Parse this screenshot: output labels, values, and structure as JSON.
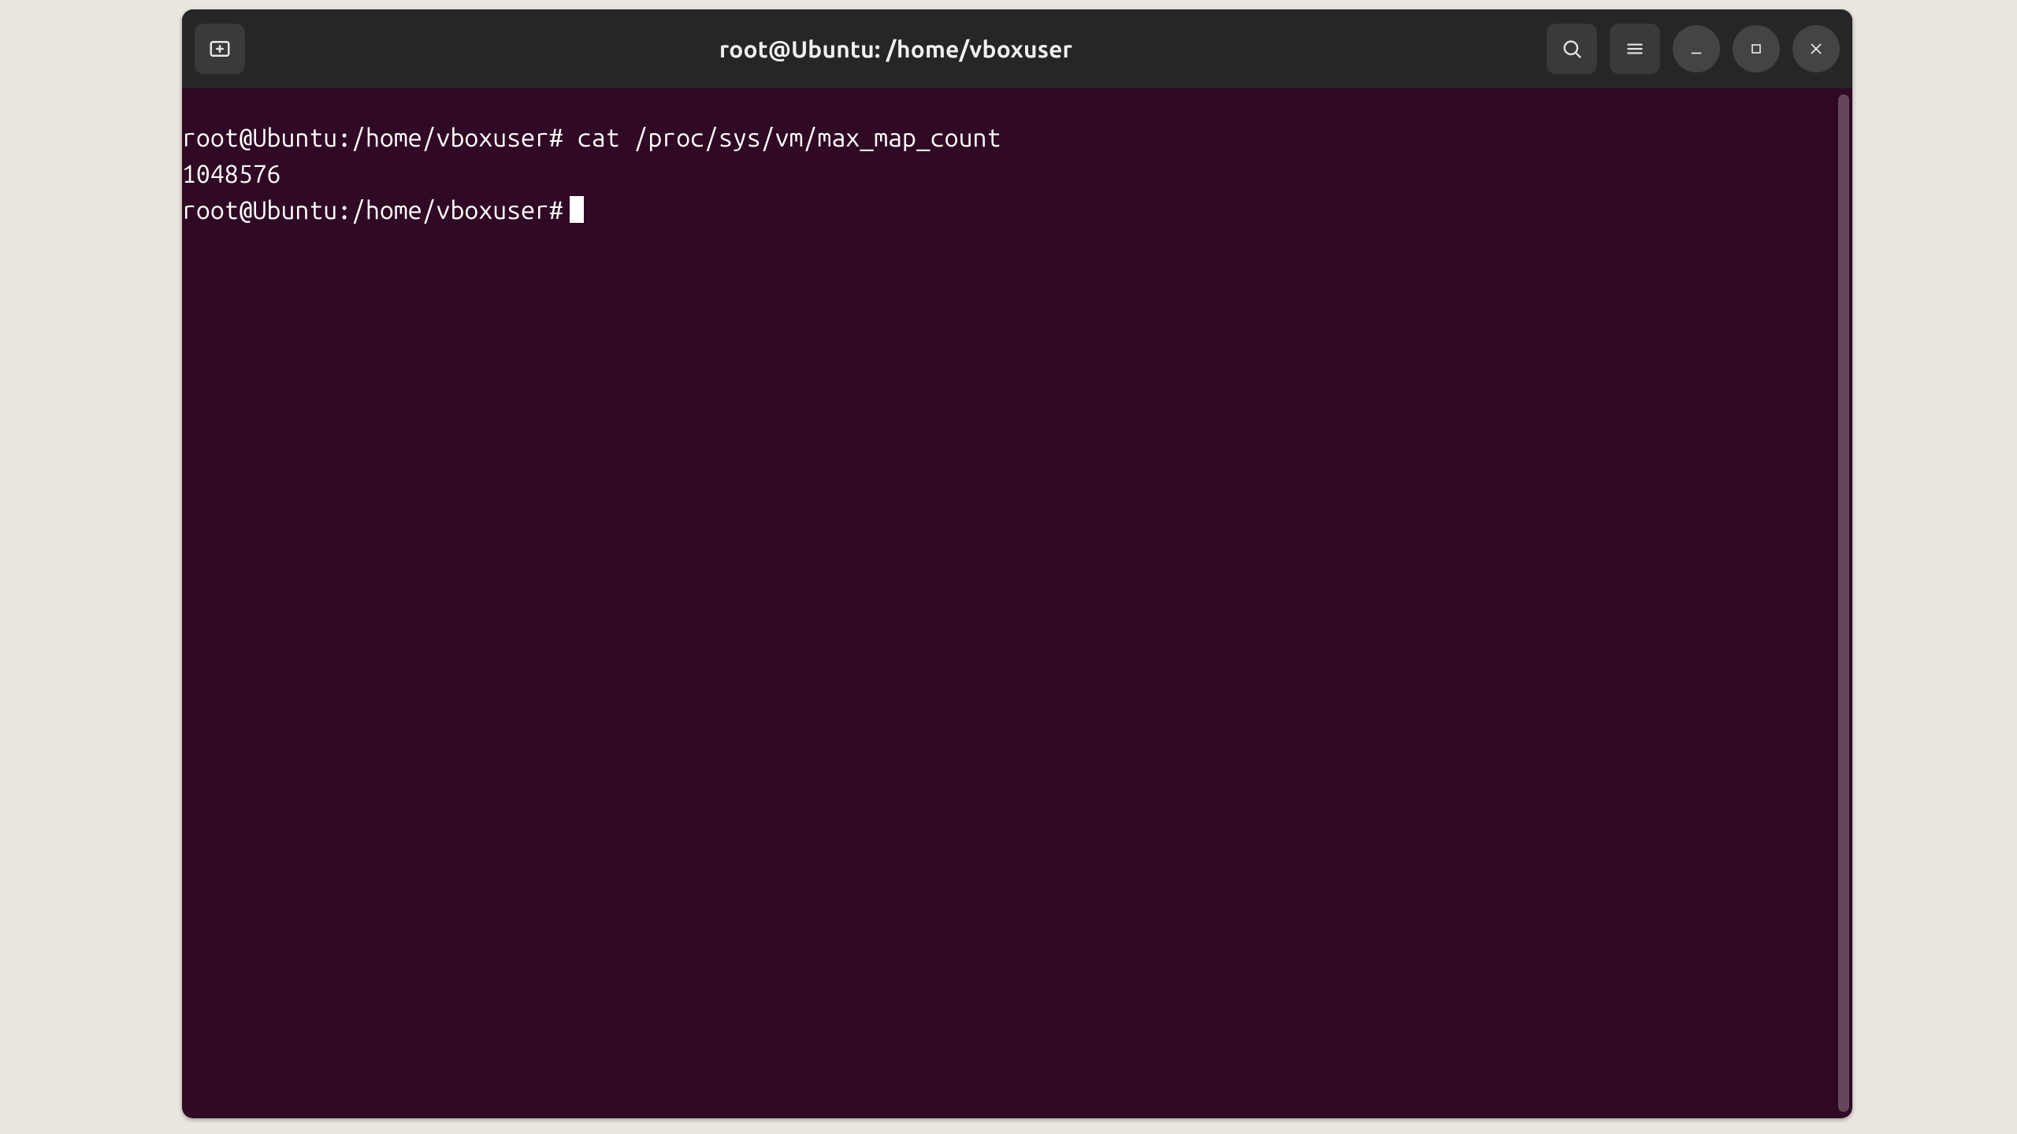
{
  "window": {
    "title": "root@Ubuntu: /home/vboxuser"
  },
  "terminal": {
    "lines": [
      {
        "prompt": "root@Ubuntu:/home/vboxuser#",
        "command": "cat /proc/sys/vm/max_map_count"
      },
      {
        "output": "1048576"
      },
      {
        "prompt": "root@Ubuntu:/home/vboxuser#",
        "command": ""
      }
    ]
  },
  "icons": {
    "new_tab": "new-tab-icon",
    "search": "search-icon",
    "menu": "hamburger-icon",
    "minimize": "minimize-icon",
    "maximize": "maximize-icon",
    "close": "close-icon"
  }
}
